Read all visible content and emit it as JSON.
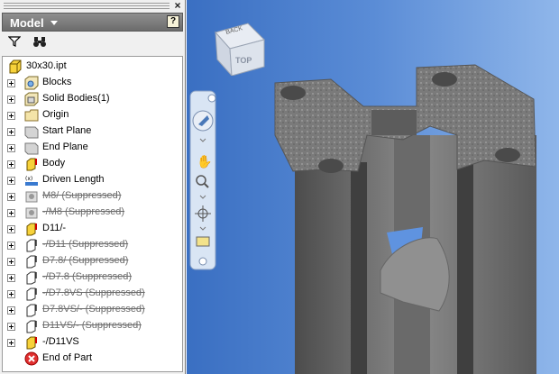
{
  "panel": {
    "title": "Model",
    "help_label": "?",
    "tools": [
      {
        "name": "filter-icon",
        "glyph": "⏷"
      },
      {
        "name": "binoculars-icon",
        "glyph": "⚲"
      }
    ]
  },
  "tree": {
    "root": {
      "label": "30x30.ipt",
      "icon": "part-file-icon"
    },
    "items": [
      {
        "label": "Blocks",
        "icon": "blocks-icon",
        "suppressed": false
      },
      {
        "label": "Solid Bodies(1)",
        "icon": "solid-bodies-icon",
        "suppressed": false
      },
      {
        "label": "Origin",
        "icon": "origin-folder-icon",
        "suppressed": false
      },
      {
        "label": "Start Plane",
        "icon": "work-plane-icon",
        "suppressed": false
      },
      {
        "label": "End Plane",
        "icon": "work-plane-icon",
        "suppressed": false
      },
      {
        "label": "Body",
        "icon": "extrusion-icon",
        "suppressed": false
      },
      {
        "label": "Driven Length",
        "icon": "driven-length-icon",
        "suppressed": false
      },
      {
        "label": "M8/ (Suppressed)",
        "icon": "hole-icon",
        "suppressed": true
      },
      {
        "label": "-/M8 (Suppressed)",
        "icon": "hole-icon",
        "suppressed": true
      },
      {
        "label": "D11/-",
        "icon": "extrusion-icon",
        "suppressed": false
      },
      {
        "label": "-/D11 (Suppressed)",
        "icon": "extrusion-outline-icon",
        "suppressed": true
      },
      {
        "label": "D7.8/ (Suppressed)",
        "icon": "extrusion-outline-icon",
        "suppressed": true
      },
      {
        "label": "-/D7.8 (Suppressed)",
        "icon": "extrusion-outline-icon",
        "suppressed": true
      },
      {
        "label": "-/D7.8VS (Suppressed)",
        "icon": "extrusion-outline-icon",
        "suppressed": true
      },
      {
        "label": "D7.8VS/- (Suppressed)",
        "icon": "extrusion-outline-icon",
        "suppressed": true
      },
      {
        "label": "D11VS/- (Suppressed)",
        "icon": "extrusion-outline-icon",
        "suppressed": true
      },
      {
        "label": "-/D11VS",
        "icon": "extrusion-icon",
        "suppressed": false
      }
    ],
    "end": {
      "label": "End of Part",
      "icon": "end-of-part-icon"
    }
  },
  "viewport": {
    "viewcube_face": "TOP",
    "viewcube_back": "BACK"
  }
}
